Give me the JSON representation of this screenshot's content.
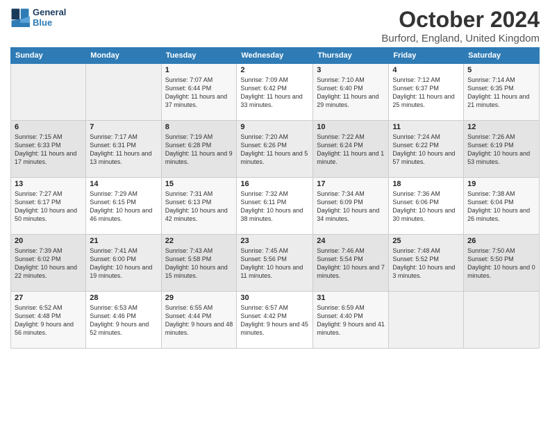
{
  "header": {
    "logo_line1": "General",
    "logo_line2": "Blue",
    "month_title": "October 2024",
    "location": "Burford, England, United Kingdom"
  },
  "days_of_week": [
    "Sunday",
    "Monday",
    "Tuesday",
    "Wednesday",
    "Thursday",
    "Friday",
    "Saturday"
  ],
  "weeks": [
    [
      {
        "day": "",
        "info": ""
      },
      {
        "day": "",
        "info": ""
      },
      {
        "day": "1",
        "info": "Sunrise: 7:07 AM\nSunset: 6:44 PM\nDaylight: 11 hours and 37 minutes."
      },
      {
        "day": "2",
        "info": "Sunrise: 7:09 AM\nSunset: 6:42 PM\nDaylight: 11 hours and 33 minutes."
      },
      {
        "day": "3",
        "info": "Sunrise: 7:10 AM\nSunset: 6:40 PM\nDaylight: 11 hours and 29 minutes."
      },
      {
        "day": "4",
        "info": "Sunrise: 7:12 AM\nSunset: 6:37 PM\nDaylight: 11 hours and 25 minutes."
      },
      {
        "day": "5",
        "info": "Sunrise: 7:14 AM\nSunset: 6:35 PM\nDaylight: 11 hours and 21 minutes."
      }
    ],
    [
      {
        "day": "6",
        "info": "Sunrise: 7:15 AM\nSunset: 6:33 PM\nDaylight: 11 hours and 17 minutes."
      },
      {
        "day": "7",
        "info": "Sunrise: 7:17 AM\nSunset: 6:31 PM\nDaylight: 11 hours and 13 minutes."
      },
      {
        "day": "8",
        "info": "Sunrise: 7:19 AM\nSunset: 6:28 PM\nDaylight: 11 hours and 9 minutes."
      },
      {
        "day": "9",
        "info": "Sunrise: 7:20 AM\nSunset: 6:26 PM\nDaylight: 11 hours and 5 minutes."
      },
      {
        "day": "10",
        "info": "Sunrise: 7:22 AM\nSunset: 6:24 PM\nDaylight: 11 hours and 1 minute."
      },
      {
        "day": "11",
        "info": "Sunrise: 7:24 AM\nSunset: 6:22 PM\nDaylight: 10 hours and 57 minutes."
      },
      {
        "day": "12",
        "info": "Sunrise: 7:26 AM\nSunset: 6:19 PM\nDaylight: 10 hours and 53 minutes."
      }
    ],
    [
      {
        "day": "13",
        "info": "Sunrise: 7:27 AM\nSunset: 6:17 PM\nDaylight: 10 hours and 50 minutes."
      },
      {
        "day": "14",
        "info": "Sunrise: 7:29 AM\nSunset: 6:15 PM\nDaylight: 10 hours and 46 minutes."
      },
      {
        "day": "15",
        "info": "Sunrise: 7:31 AM\nSunset: 6:13 PM\nDaylight: 10 hours and 42 minutes."
      },
      {
        "day": "16",
        "info": "Sunrise: 7:32 AM\nSunset: 6:11 PM\nDaylight: 10 hours and 38 minutes."
      },
      {
        "day": "17",
        "info": "Sunrise: 7:34 AM\nSunset: 6:09 PM\nDaylight: 10 hours and 34 minutes."
      },
      {
        "day": "18",
        "info": "Sunrise: 7:36 AM\nSunset: 6:06 PM\nDaylight: 10 hours and 30 minutes."
      },
      {
        "day": "19",
        "info": "Sunrise: 7:38 AM\nSunset: 6:04 PM\nDaylight: 10 hours and 26 minutes."
      }
    ],
    [
      {
        "day": "20",
        "info": "Sunrise: 7:39 AM\nSunset: 6:02 PM\nDaylight: 10 hours and 22 minutes."
      },
      {
        "day": "21",
        "info": "Sunrise: 7:41 AM\nSunset: 6:00 PM\nDaylight: 10 hours and 19 minutes."
      },
      {
        "day": "22",
        "info": "Sunrise: 7:43 AM\nSunset: 5:58 PM\nDaylight: 10 hours and 15 minutes."
      },
      {
        "day": "23",
        "info": "Sunrise: 7:45 AM\nSunset: 5:56 PM\nDaylight: 10 hours and 11 minutes."
      },
      {
        "day": "24",
        "info": "Sunrise: 7:46 AM\nSunset: 5:54 PM\nDaylight: 10 hours and 7 minutes."
      },
      {
        "day": "25",
        "info": "Sunrise: 7:48 AM\nSunset: 5:52 PM\nDaylight: 10 hours and 3 minutes."
      },
      {
        "day": "26",
        "info": "Sunrise: 7:50 AM\nSunset: 5:50 PM\nDaylight: 10 hours and 0 minutes."
      }
    ],
    [
      {
        "day": "27",
        "info": "Sunrise: 6:52 AM\nSunset: 4:48 PM\nDaylight: 9 hours and 56 minutes."
      },
      {
        "day": "28",
        "info": "Sunrise: 6:53 AM\nSunset: 4:46 PM\nDaylight: 9 hours and 52 minutes."
      },
      {
        "day": "29",
        "info": "Sunrise: 6:55 AM\nSunset: 4:44 PM\nDaylight: 9 hours and 48 minutes."
      },
      {
        "day": "30",
        "info": "Sunrise: 6:57 AM\nSunset: 4:42 PM\nDaylight: 9 hours and 45 minutes."
      },
      {
        "day": "31",
        "info": "Sunrise: 6:59 AM\nSunset: 4:40 PM\nDaylight: 9 hours and 41 minutes."
      },
      {
        "day": "",
        "info": ""
      },
      {
        "day": "",
        "info": ""
      }
    ]
  ]
}
